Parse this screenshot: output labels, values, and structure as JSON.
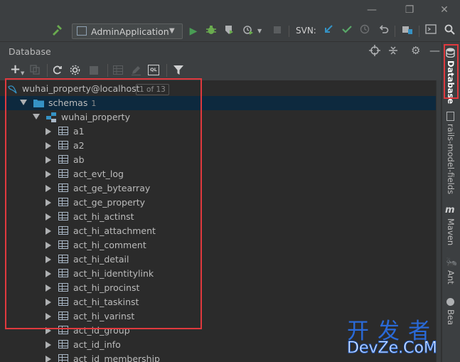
{
  "toolbar": {
    "run_config": "AdminApplication",
    "svn_label": "SVN:"
  },
  "panel": {
    "title": "Database"
  },
  "tree": {
    "datasource": {
      "label": "wuhai_property@localhost",
      "badge": "1 of 13"
    },
    "schemas": {
      "label": "schemas",
      "count": "1"
    },
    "schema": {
      "label": "wuhai_property"
    },
    "tables": [
      "a1",
      "a2",
      "ab",
      "act_evt_log",
      "act_ge_bytearray",
      "act_ge_property",
      "act_hi_actinst",
      "act_hi_attachment",
      "act_hi_comment",
      "act_hi_detail",
      "act_hi_identitylink",
      "act_hi_procinst",
      "act_hi_taskinst",
      "act_hi_varinst",
      "act_id_group",
      "act_id_info",
      "act_id_membership"
    ]
  },
  "side_tabs": {
    "database": "Database",
    "rails": "rails-model-fields",
    "maven": "Maven",
    "ant": "Ant",
    "extra": "Bea"
  },
  "watermark": {
    "line1": "开发者",
    "line2": "DevZe.CoM"
  },
  "colors": {
    "run_green": "#499c54",
    "debug_green": "#6aab4f",
    "svn_blue": "#3592c4",
    "svn_check": "#59a869",
    "highlight_red": "#e0393e",
    "selection": "#0d293e"
  }
}
